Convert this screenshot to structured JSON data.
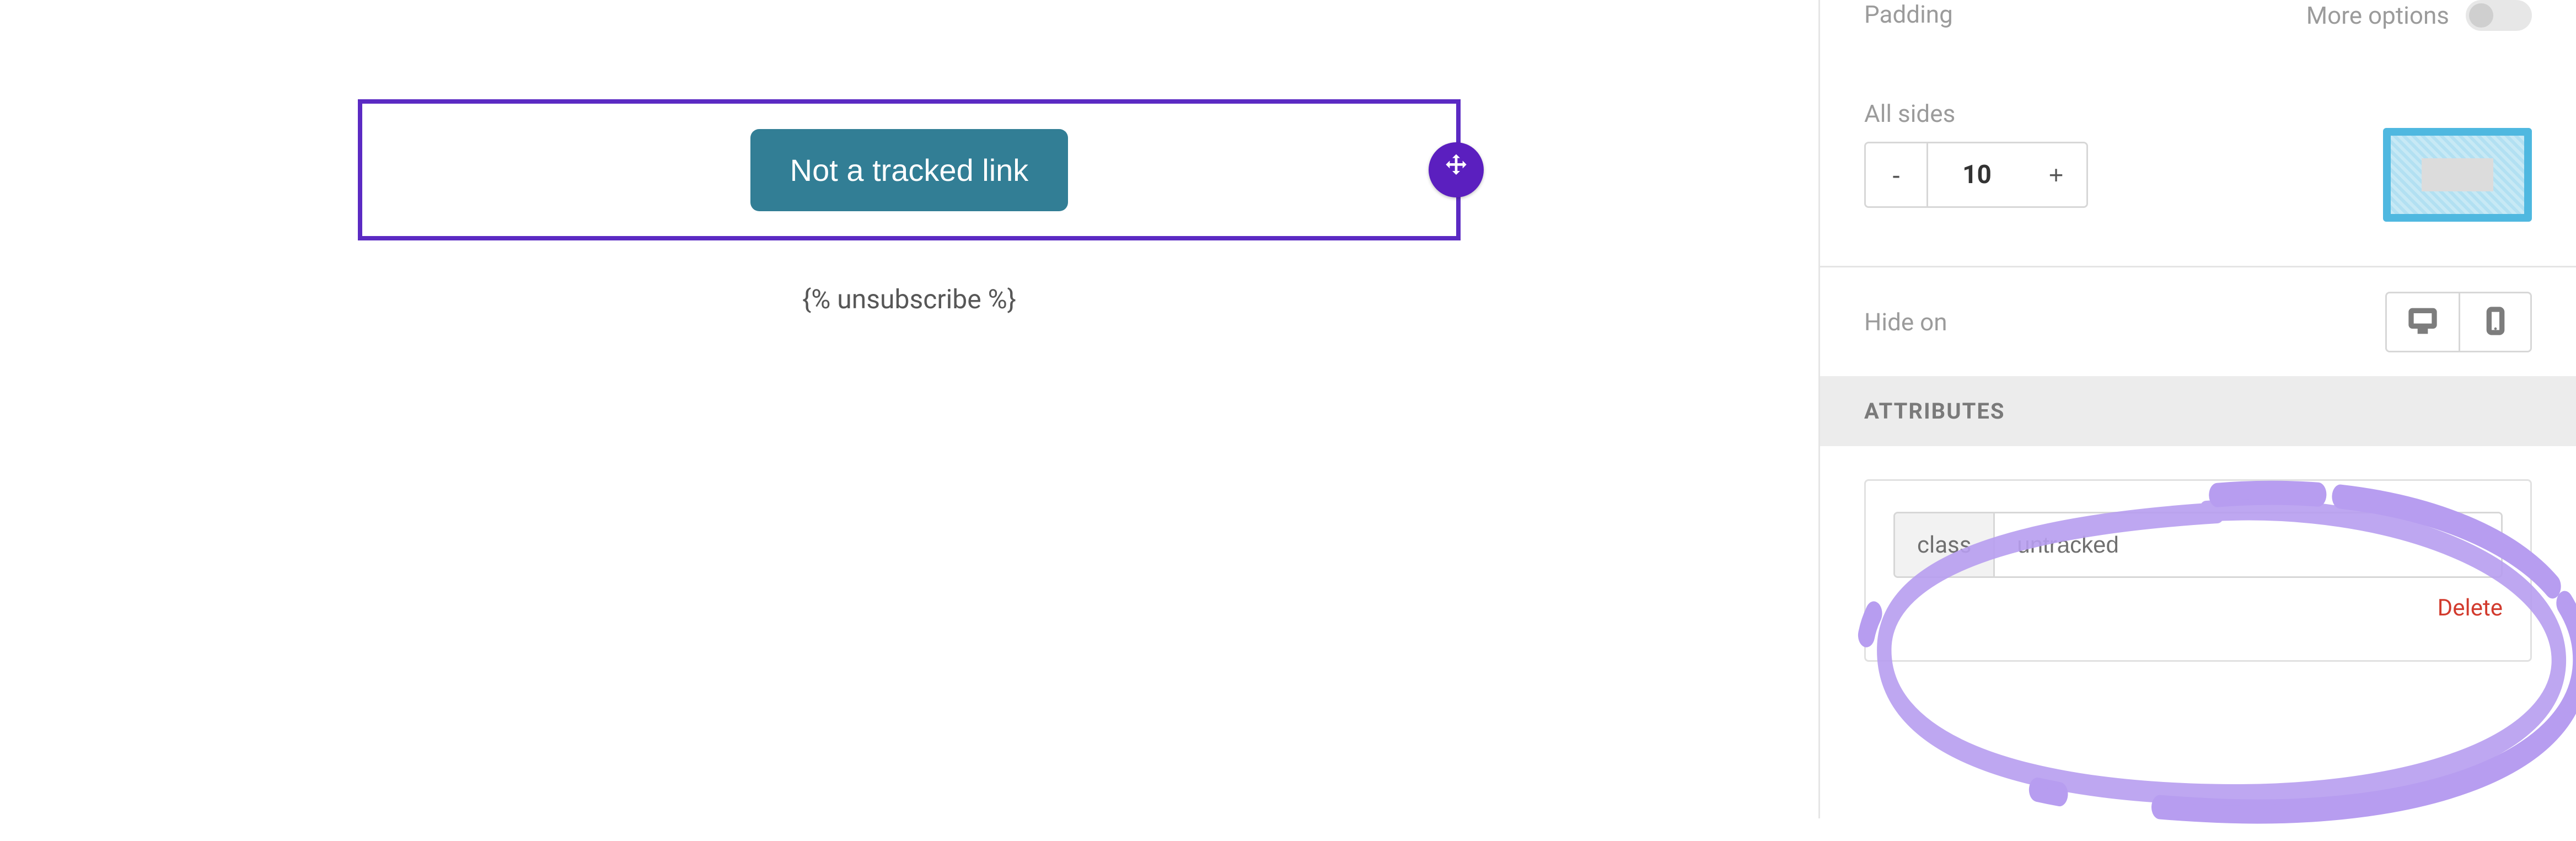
{
  "canvas": {
    "button_label": "Not a tracked link",
    "unsubscribe_token": "{% unsubscribe %}"
  },
  "sidebar": {
    "padding": {
      "label": "Padding",
      "more_label": "More options",
      "all_sides_label": "All sides",
      "value": "10",
      "decrement": "-",
      "increment": "+"
    },
    "hide_on": {
      "label": "Hide on"
    },
    "attributes": {
      "header": "ATTRIBUTES",
      "class_label": "class",
      "class_value": "untracked",
      "delete_label": "Delete"
    }
  }
}
